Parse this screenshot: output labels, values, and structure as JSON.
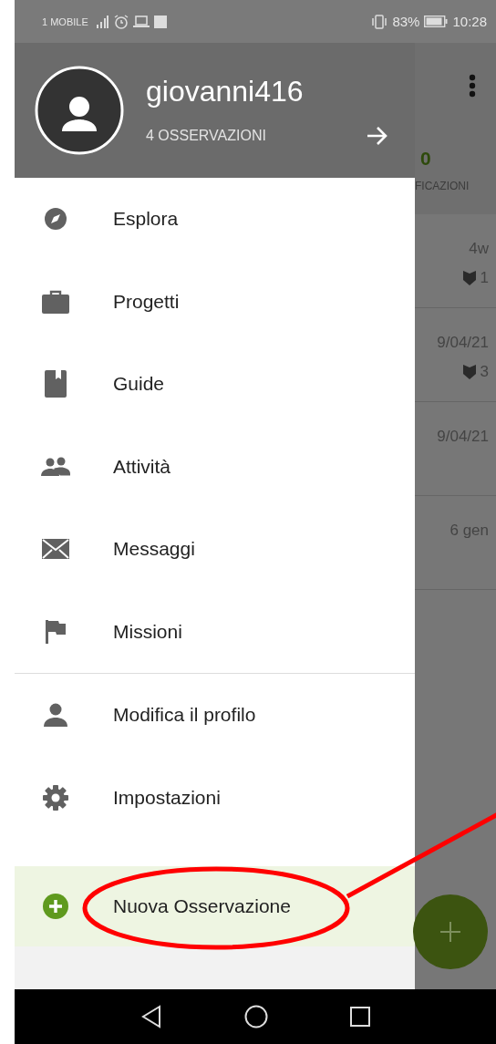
{
  "status_bar": {
    "carrier": "1 MOBILE",
    "battery": "83%",
    "time": "10:28"
  },
  "drawer": {
    "username": "giovanni416",
    "observations": "4 OSSERVAZIONI",
    "sections": [
      [
        {
          "label": "Esplora"
        },
        {
          "label": "Progetti"
        },
        {
          "label": "Guide"
        },
        {
          "label": "Attività"
        },
        {
          "label": "Messaggi"
        },
        {
          "label": "Missioni"
        }
      ],
      [
        {
          "label": "Modifica il profilo"
        },
        {
          "label": "Impostazioni"
        }
      ]
    ],
    "action": {
      "label": "Nuova Osservazione",
      "highlighted": true
    }
  },
  "background_screen": {
    "count": "0",
    "count_label": "FICAZIONI",
    "rows": [
      {
        "date": "4w",
        "count": "1"
      },
      {
        "date": "9/04/21",
        "count": "3"
      },
      {
        "date": "9/04/21"
      },
      {
        "date": "6 gen"
      }
    ]
  }
}
